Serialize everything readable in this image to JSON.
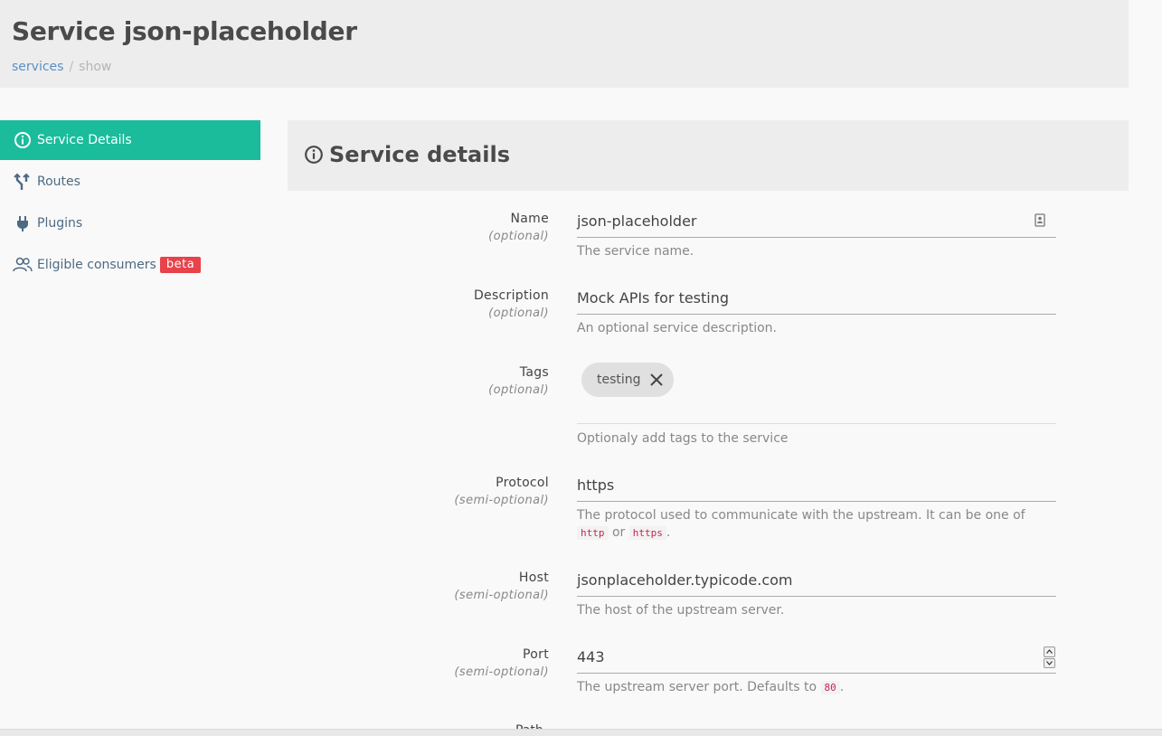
{
  "header": {
    "title": "Service json-placeholder",
    "breadcrumb": {
      "link": "services",
      "separator": "/",
      "current": "show"
    }
  },
  "sidebar": {
    "items": [
      {
        "label": "Service Details",
        "icon": "info-icon",
        "active": true
      },
      {
        "label": "Routes",
        "icon": "routes-icon",
        "active": false
      },
      {
        "label": "Plugins",
        "icon": "plug-icon",
        "active": false
      },
      {
        "label": "Eligible consumers",
        "icon": "users-icon",
        "active": false,
        "badge": "beta"
      }
    ]
  },
  "panel": {
    "title": "Service details",
    "icon": "info-icon"
  },
  "form": {
    "name": {
      "label": "Name",
      "optional": "(optional)",
      "value": "json-placeholder",
      "help": "The service name."
    },
    "description": {
      "label": "Description",
      "optional": "(optional)",
      "value": "Mock APIs for testing",
      "help": "An optional service description."
    },
    "tags": {
      "label": "Tags",
      "optional": "(optional)",
      "chips": [
        "testing"
      ],
      "help": "Optionaly add tags to the service"
    },
    "protocol": {
      "label": "Protocol",
      "optional": "(semi-optional)",
      "value": "https",
      "help_text": "The protocol used to communicate with the upstream. It can be one of",
      "help_code1": "http",
      "help_or": "or",
      "help_code2": "https",
      "help_end": "."
    },
    "host": {
      "label": "Host",
      "optional": "(semi-optional)",
      "value": "jsonplaceholder.typicode.com",
      "help": "The host of the upstream server."
    },
    "port": {
      "label": "Port",
      "optional": "(semi-optional)",
      "value": "443",
      "help_text": "The upstream server port. Defaults to",
      "help_code": "80",
      "help_end": "."
    },
    "next_label": "Path"
  },
  "colors": {
    "accent": "#1abc9c",
    "badge": "#e8424b",
    "link": "#5a8fc6"
  }
}
